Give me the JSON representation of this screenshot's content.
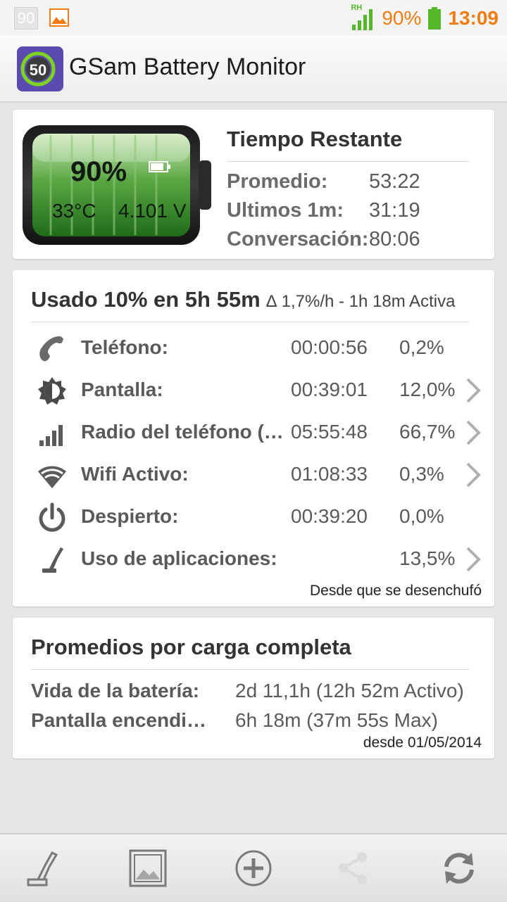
{
  "status_bar": {
    "left_number": "90",
    "network_label": "RH",
    "battery_percent": "90%",
    "time": "13:09"
  },
  "app": {
    "icon_number": "50",
    "title": "GSam Battery Monitor"
  },
  "battery_card": {
    "percent": "90%",
    "level": 0.9,
    "temperature": "33°C",
    "voltage": "4.101 V",
    "title": "Tiempo Restante",
    "rows": [
      {
        "label": "Promedio:",
        "value": "53:22"
      },
      {
        "label": "Ultimos 1m:",
        "value": "31:19"
      },
      {
        "label": "Conversación:",
        "value": "80:06"
      }
    ]
  },
  "usage_card": {
    "title": "Usado 10% en 5h 55m",
    "subtitle": "∆ 1,7%/h - 1h 18m Activa",
    "rows": [
      {
        "icon": "phone-icon",
        "name": "Teléfono:",
        "time": "00:00:56",
        "percent": "0,2%",
        "chevron": false
      },
      {
        "icon": "brightness-icon",
        "name": "Pantalla:",
        "time": "00:39:01",
        "percent": "12,0%",
        "chevron": true
      },
      {
        "icon": "signal-icon",
        "name": "Radio del teléfono (…",
        "time": "05:55:48",
        "percent": "66,7%",
        "chevron": true
      },
      {
        "icon": "wifi-icon",
        "name": "Wifi Activo:",
        "time": "01:08:33",
        "percent": "0,3%",
        "chevron": true
      },
      {
        "icon": "power-icon",
        "name": "Despierto:",
        "time": "00:39:20",
        "percent": "0,0%",
        "chevron": false
      },
      {
        "icon": "plug-icon",
        "name": "Uso de aplicaciones:",
        "time": "",
        "percent": "13,5%",
        "chevron": true
      }
    ],
    "footer": "Desde que se desenchufó"
  },
  "averages_card": {
    "title": "Promedios por carga completa",
    "rows": [
      {
        "label": "Vida de la batería:",
        "value": "2d 11,1h (12h 52m Activo)"
      },
      {
        "label": "Pantalla encendi…",
        "value": "6h 18m (37m 55s Max)"
      }
    ],
    "footer": "desde 01/05/2014"
  },
  "bottom_bar": {
    "buttons": [
      "plug-icon",
      "image-icon",
      "add-icon",
      "share-icon",
      "refresh-icon"
    ]
  },
  "colors": {
    "accent_orange": "#ef7d14",
    "battery_green": "#2f8a2a",
    "signal_green": "#55b82a",
    "app_icon_purple": "#5a4bb0"
  }
}
